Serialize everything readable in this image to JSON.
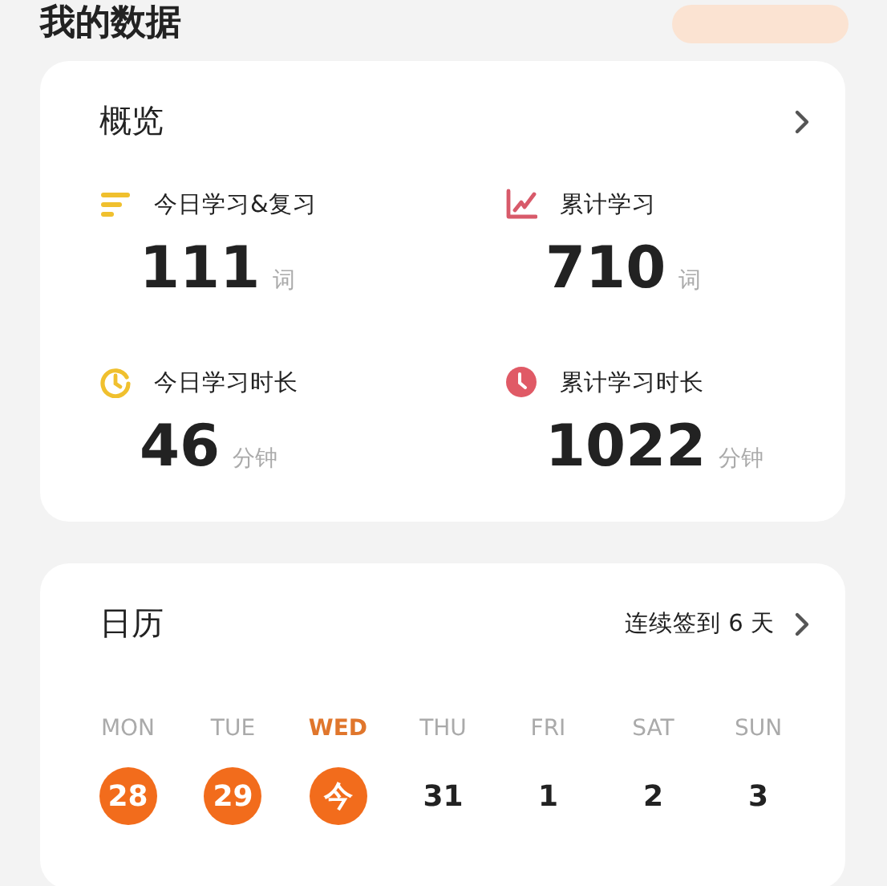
{
  "page_title": "我的数据",
  "overview": {
    "title": "概览",
    "stats": [
      {
        "kind": "bars",
        "label": "今日学习&复习",
        "value": "111",
        "unit": "词"
      },
      {
        "kind": "chart",
        "label": "累计学习",
        "value": "710",
        "unit": "词"
      },
      {
        "kind": "ring",
        "label": "今日学习时长",
        "value": "46",
        "unit": "分钟"
      },
      {
        "kind": "clock",
        "label": "累计学习时长",
        "value": "1022",
        "unit": "分钟"
      }
    ]
  },
  "calendar": {
    "title": "日历",
    "streak": "连续签到 6 天",
    "days": [
      {
        "weekday": "MON",
        "date": "28",
        "signed": true,
        "today": false
      },
      {
        "weekday": "TUE",
        "date": "29",
        "signed": true,
        "today": false
      },
      {
        "weekday": "WED",
        "date": "今",
        "signed": true,
        "today": true
      },
      {
        "weekday": "THU",
        "date": "31",
        "signed": false,
        "today": false
      },
      {
        "weekday": "FRI",
        "date": "1",
        "signed": false,
        "today": false
      },
      {
        "weekday": "SAT",
        "date": "2",
        "signed": false,
        "today": false
      },
      {
        "weekday": "SUN",
        "date": "3",
        "signed": false,
        "today": false
      }
    ]
  }
}
